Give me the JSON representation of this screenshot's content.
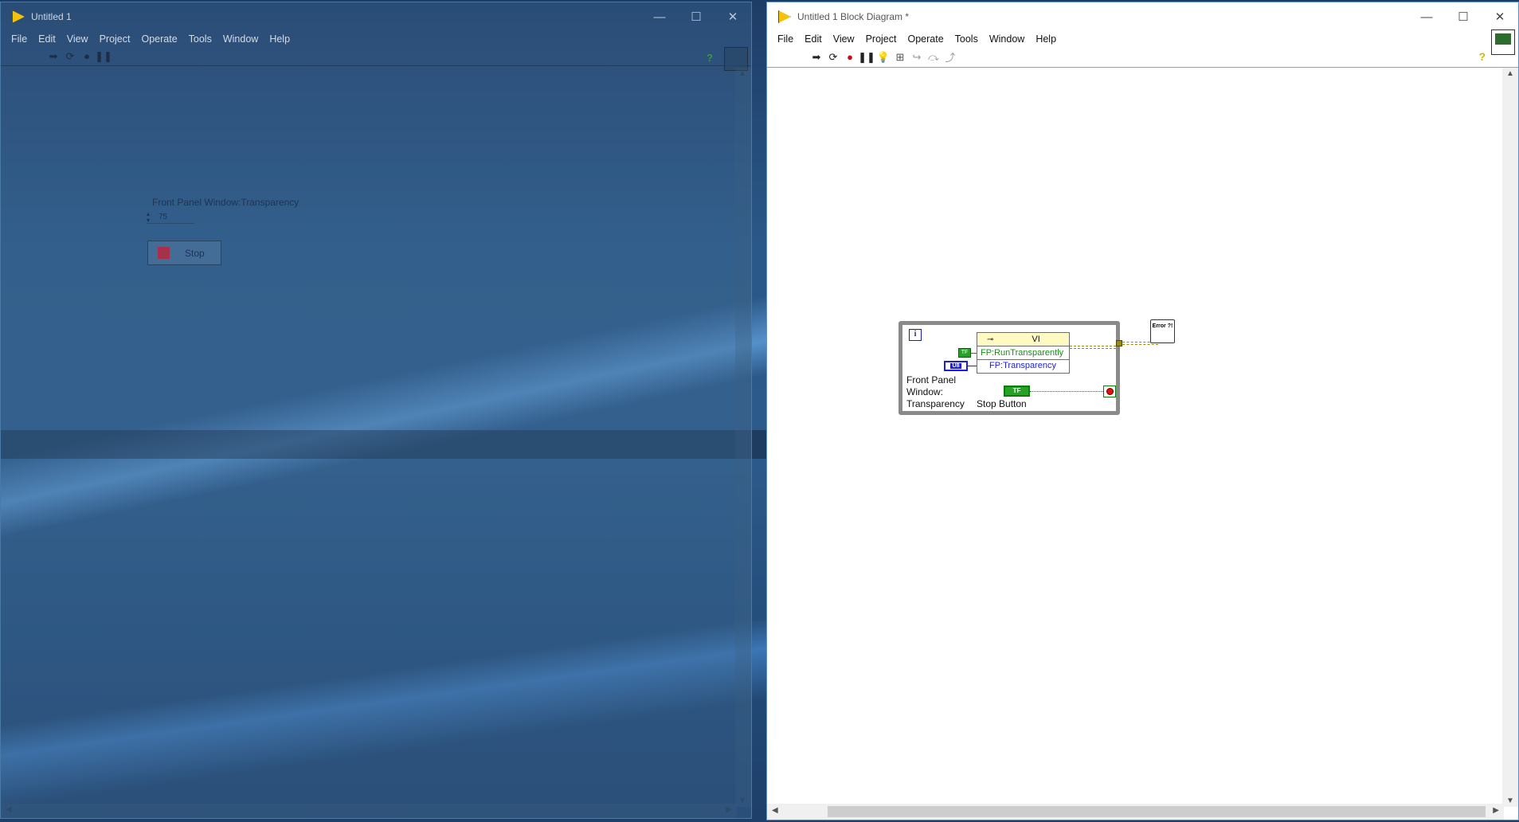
{
  "front_panel": {
    "title": "Untitled 1",
    "menu": [
      "File",
      "Edit",
      "View",
      "Project",
      "Operate",
      "Tools",
      "Window",
      "Help"
    ],
    "numeric_label": "Front Panel Window:Transparency",
    "numeric_value": "75",
    "stop_button_label": "Stop",
    "toolbar_icons": [
      "run-icon",
      "run-continuously-icon",
      "abort-icon",
      "pause-icon"
    ],
    "help_icon": "?",
    "background_opacity_percent": 75
  },
  "block_diagram": {
    "title": "Untitled 1 Block Diagram *",
    "menu": [
      "File",
      "Edit",
      "View",
      "Project",
      "Operate",
      "Tools",
      "Window",
      "Help"
    ],
    "toolbar_icons": [
      "run-icon",
      "run-continuously-icon",
      "abort-icon",
      "pause-icon",
      "highlight-execution-icon",
      "retain-wire-values-icon",
      "step-into-icon",
      "step-over-icon",
      "step-out-icon"
    ],
    "help_icon": "?",
    "iteration_terminal": "i",
    "property_node": {
      "ref": "VI",
      "prop1": "FP:RunTransparently",
      "prop2": "FP:Transparency"
    },
    "bool_const": "TF",
    "u8_label": "U8",
    "tf_label": "TF",
    "fp_window_label": "Front Panel Window: Transparency",
    "stop_button_label": "Stop Button",
    "error_handler_text": "Error ?!"
  },
  "colors": {
    "accent_yellow": "#f4c20d",
    "wire_boolean": "#1a8c1a",
    "wire_u8": "#1e1ee0",
    "wire_error": "#9a8a10",
    "stop_led": "#a8304e"
  }
}
